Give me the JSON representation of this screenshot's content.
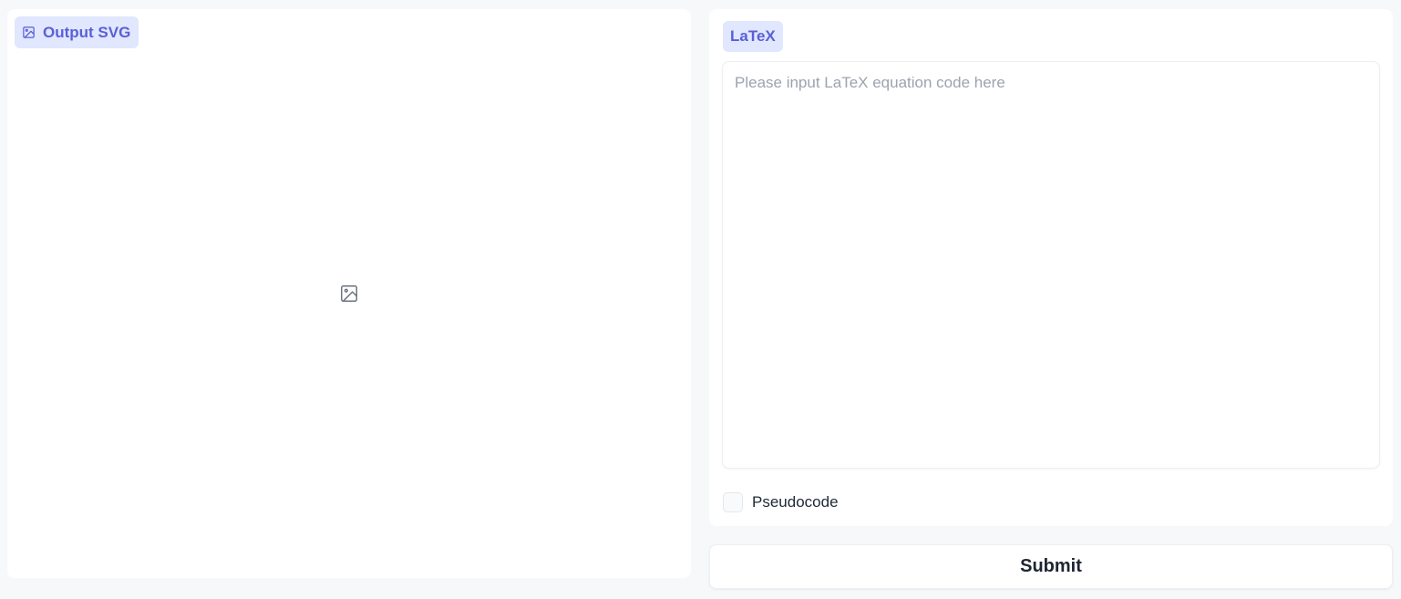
{
  "output_panel": {
    "label": "Output SVG",
    "label_icon": "image-icon",
    "placeholder_icon": "image-placeholder-icon"
  },
  "input_panel": {
    "label": "LaTeX",
    "input_value": "",
    "input_placeholder": "Please input LaTeX equation code here",
    "checkbox_label": "Pseudocode",
    "checkbox_checked": false
  },
  "submit_label": "Submit",
  "colors": {
    "accent": "#5b5fd6",
    "chip_bg": "#e0e7ff",
    "page_bg": "#f7f8fa",
    "panel_bg": "#ffffff",
    "placeholder_text": "#9ca3af"
  }
}
